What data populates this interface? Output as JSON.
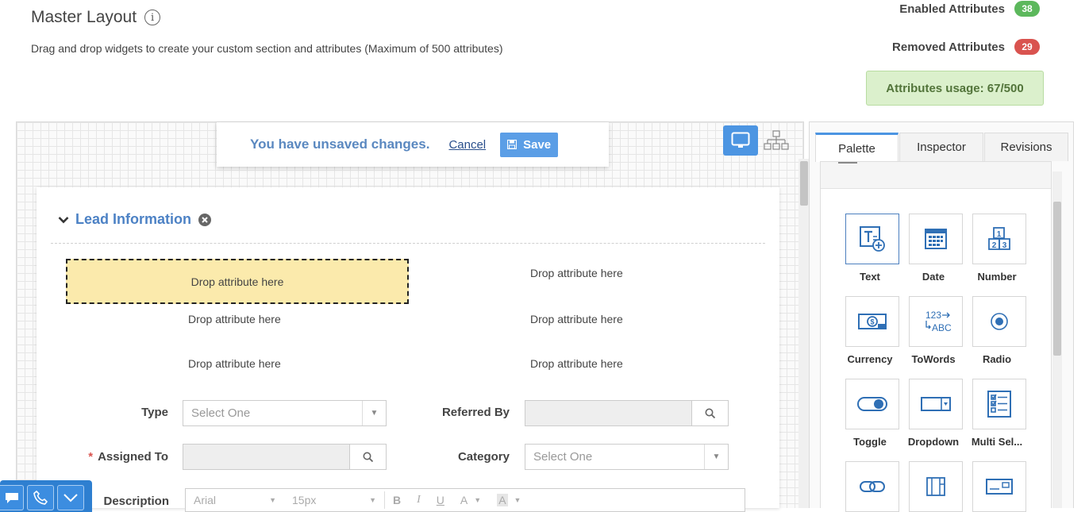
{
  "header": {
    "title": "Master Layout",
    "info_glyph": "i",
    "description": "Drag and drop widgets to create your custom section and attributes (Maximum of 500 attributes)"
  },
  "stats": {
    "enabled_label": "Enabled Attributes",
    "enabled_count": "38",
    "enabled_color": "#5cb85c",
    "removed_label": "Removed Attributes",
    "removed_count": "29",
    "removed_color": "#d9534f",
    "usage_text": "Attributes usage: 67/500"
  },
  "unsaved": {
    "message": "You have unsaved changes.",
    "cancel_label": "Cancel",
    "save_label": "Save"
  },
  "view_toggle": {
    "desktop_icon": "desktop-icon",
    "tree_icon": "sitemap-icon"
  },
  "section": {
    "title": "Lead Information",
    "drop_slots": [
      "Drop attribute here",
      "Drop attribute here",
      "Drop attribute here",
      "Drop attribute here",
      "Drop attribute here",
      "Drop attribute here"
    ],
    "fields": {
      "type_label": "Type",
      "type_placeholder": "Select One",
      "referred_by_label": "Referred By",
      "assigned_to_label": "Assigned To",
      "assigned_to_required": "*",
      "category_label": "Category",
      "category_placeholder": "Select One",
      "description_label": "Description"
    },
    "editor_toolbar": {
      "font": "Arial",
      "size": "15px",
      "bold": "B",
      "italic": "I",
      "underline": "U",
      "font_color": "A",
      "bg_color": "A"
    }
  },
  "panel": {
    "tabs": [
      "Palette",
      "Inspector",
      "Revisions"
    ],
    "active_tab": "Palette",
    "widgets": [
      {
        "label": "Text",
        "icon": "text-add-icon"
      },
      {
        "label": "Date",
        "icon": "calendar-icon"
      },
      {
        "label": "Number",
        "icon": "number-icon"
      },
      {
        "label": "Currency",
        "icon": "currency-icon"
      },
      {
        "label": "ToWords",
        "icon": "towords-icon"
      },
      {
        "label": "Radio",
        "icon": "radio-icon"
      },
      {
        "label": "Toggle",
        "icon": "toggle-icon"
      },
      {
        "label": "Dropdown",
        "icon": "dropdown-icon"
      },
      {
        "label": "Multi Sel...",
        "icon": "multi-select-icon"
      },
      {
        "label": "",
        "icon": "link-icon"
      },
      {
        "label": "",
        "icon": "layout-icon"
      },
      {
        "label": "",
        "icon": "input-box-icon"
      }
    ],
    "towords_glyph_top": "123",
    "towords_glyph_bottom": "ABC",
    "number_glyphs": [
      "1",
      "2",
      "3"
    ]
  },
  "chat_bar": {
    "icons": [
      "chat-icon",
      "phone-icon",
      "chevron-down-icon"
    ]
  }
}
